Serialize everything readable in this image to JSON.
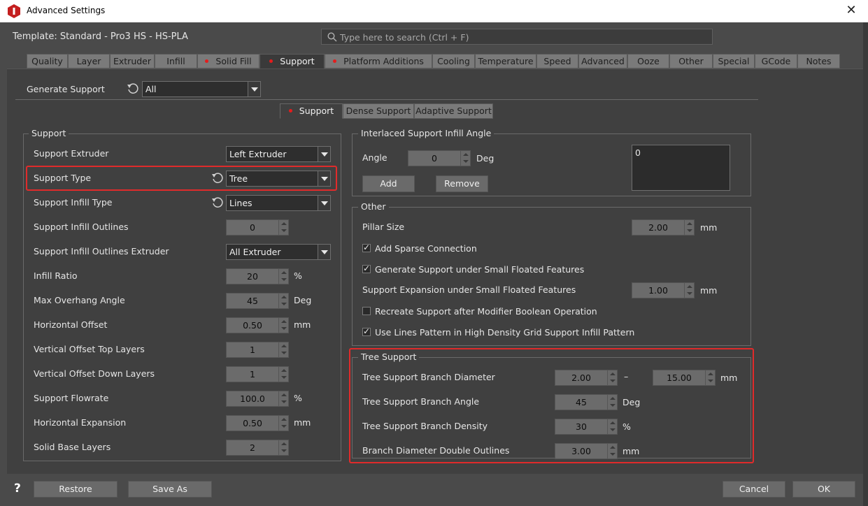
{
  "window": {
    "title": "Advanced Settings",
    "template": "Template: Standard - Pro3 HS - HS-PLA"
  },
  "search": {
    "placeholder": "Type here to search (Ctrl + F)"
  },
  "tabs": [
    {
      "label": "Quality"
    },
    {
      "label": "Layer"
    },
    {
      "label": "Extruder"
    },
    {
      "label": "Infill"
    },
    {
      "label": "Solid Fill",
      "dot": true
    },
    {
      "label": "Support",
      "dot": true,
      "active": true
    },
    {
      "label": "Platform Additions",
      "dot": true
    },
    {
      "label": "Cooling"
    },
    {
      "label": "Temperature"
    },
    {
      "label": "Speed"
    },
    {
      "label": "Advanced"
    },
    {
      "label": "Ooze"
    },
    {
      "label": "Other"
    },
    {
      "label": "Special"
    },
    {
      "label": "GCode"
    },
    {
      "label": "Notes"
    }
  ],
  "generate_support": {
    "label": "Generate Support",
    "value": "All"
  },
  "subtabs": [
    {
      "label": "Support",
      "dot": true,
      "active": true
    },
    {
      "label": "Dense Support"
    },
    {
      "label": "Adaptive Support"
    }
  ],
  "support_group": {
    "title": "Support",
    "extruder": {
      "label": "Support Extruder",
      "value": "Left Extruder"
    },
    "type": {
      "label": "Support Type",
      "value": "Tree"
    },
    "infill_type": {
      "label": "Support Infill Type",
      "value": "Lines"
    },
    "infill_outlines": {
      "label": "Support Infill Outlines",
      "value": "0"
    },
    "outlines_extruder": {
      "label": "Support Infill Outlines Extruder",
      "value": "All Extruder"
    },
    "infill_ratio": {
      "label": "Infill Ratio",
      "value": "20",
      "unit": "%"
    },
    "overhang": {
      "label": "Max Overhang Angle",
      "value": "45",
      "unit": "Deg"
    },
    "h_offset": {
      "label": "Horizontal Offset",
      "value": "0.50",
      "unit": "mm"
    },
    "v_top": {
      "label": "Vertical Offset Top Layers",
      "value": "1"
    },
    "v_down": {
      "label": "Vertical Offset Down Layers",
      "value": "1"
    },
    "flowrate": {
      "label": "Support Flowrate",
      "value": "100.0",
      "unit": "%"
    },
    "h_expansion": {
      "label": "Horizontal Expansion",
      "value": "0.50",
      "unit": "mm"
    },
    "solid_base": {
      "label": "Solid Base Layers",
      "value": "2"
    }
  },
  "interlaced": {
    "title": "Interlaced Support Infill Angle",
    "angle_label": "Angle",
    "angle_value": "0",
    "angle_unit": "Deg",
    "add": "Add",
    "remove": "Remove",
    "list_item": "0"
  },
  "other": {
    "title": "Other",
    "pillar": {
      "label": "Pillar Size",
      "value": "2.00",
      "unit": "mm"
    },
    "sparse": {
      "label": "Add Sparse Connection",
      "checked": true
    },
    "small_floated": {
      "label": "Generate Support under Small Floated Features",
      "checked": true
    },
    "expansion": {
      "label": "Support Expansion under Small Floated Features",
      "value": "1.00",
      "unit": "mm"
    },
    "recreate": {
      "label": "Recreate Support after Modifier Boolean Operation",
      "checked": false
    },
    "lines_pattern": {
      "label": "Use Lines Pattern in High Density Grid Support Infill Pattern",
      "checked": true
    }
  },
  "tree": {
    "title": "Tree Support",
    "diameter": {
      "label": "Tree Support Branch Diameter",
      "min": "2.00",
      "sep": "–",
      "max": "15.00",
      "unit": "mm"
    },
    "angle": {
      "label": "Tree Support Branch Angle",
      "value": "45",
      "unit": "Deg"
    },
    "density": {
      "label": "Tree Support Branch Density",
      "value": "30",
      "unit": "%"
    },
    "double": {
      "label": "Branch Diameter Double Outlines",
      "value": "3.00",
      "unit": "mm"
    }
  },
  "footer": {
    "help": "?",
    "restore": "Restore",
    "save_as": "Save As",
    "cancel": "Cancel",
    "ok": "OK"
  },
  "colors": {
    "highlight": "#e02b2b",
    "dot": "#e41c1c"
  }
}
